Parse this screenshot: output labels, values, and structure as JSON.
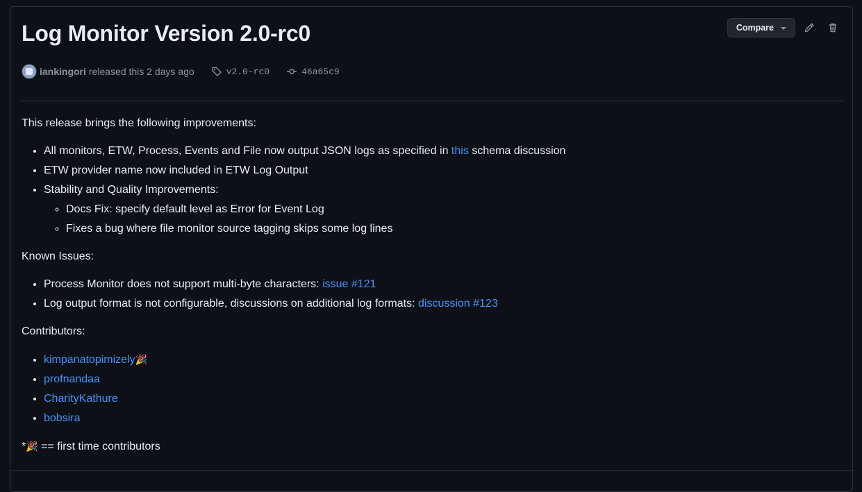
{
  "release": {
    "title": "Log Monitor Version 2.0-rc0",
    "author": "iankingori",
    "released_text": "released this 2 days ago",
    "tag": "v2.0-rc0",
    "commit": "46a65c9"
  },
  "actions": {
    "compare_label": "Compare"
  },
  "body": {
    "intro": "This release brings the following improvements:",
    "improvements": {
      "item1_before": "All monitors, ETW, Process, Events and File now output JSON logs as specified in ",
      "item1_link": "this",
      "item1_after": " schema discussion",
      "item2": "ETW provider name now included in ETW Log Output",
      "item3": "Stability and Quality Improvements:",
      "sub1": "Docs Fix: specify default level as Error for Event Log",
      "sub2": "Fixes a bug where file monitor source tagging skips some log lines"
    },
    "known_issues_heading": "Known Issues:",
    "known_issues": {
      "item1_text": "Process Monitor does not support multi-byte characters: ",
      "item1_link": "issue #121",
      "item2_text": "Log output format is not configurable, discussions on additional log formats: ",
      "item2_link": "discussion #123"
    },
    "contributors_heading": "Contributors:",
    "contributors": [
      "kimpanatopimizely",
      "profnandaa",
      "CharityKathure",
      "bobsira"
    ],
    "first_time_emoji": "🎉",
    "footnote_star": "*",
    "footnote_text": " == first time contributors"
  },
  "colors": {
    "background": "#0d1117",
    "border": "#30363d",
    "text": "#e6edf3",
    "muted": "#8b949e",
    "link": "#4493f8"
  }
}
